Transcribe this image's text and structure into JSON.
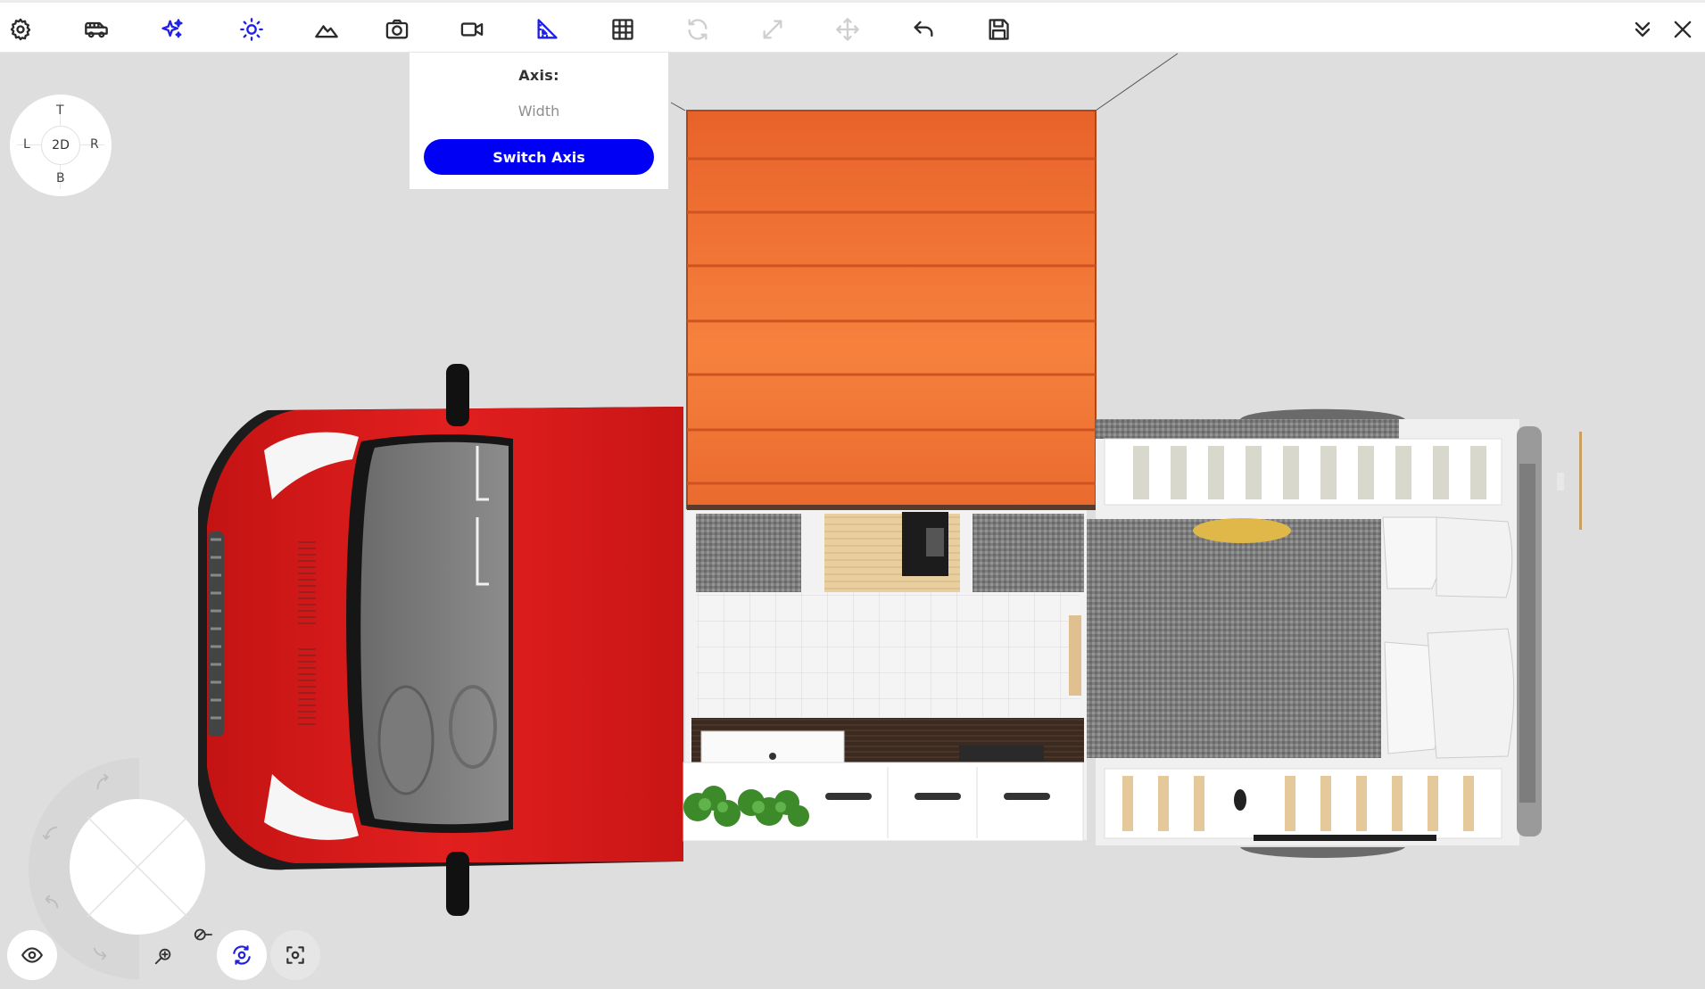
{
  "toolbar": {
    "left_icons": [
      {
        "name": "settings-gear-icon",
        "state": "normal"
      },
      {
        "name": "van-icon",
        "state": "normal"
      },
      {
        "name": "sparkle-icon",
        "state": "active"
      },
      {
        "name": "sun-lighting-icon",
        "state": "active"
      },
      {
        "name": "terrain-mountain-icon",
        "state": "normal"
      },
      {
        "name": "camera-icon",
        "state": "normal"
      },
      {
        "name": "video-camera-icon",
        "state": "normal"
      },
      {
        "name": "ruler-measure-icon",
        "state": "active"
      },
      {
        "name": "grid-icon",
        "state": "normal"
      },
      {
        "name": "rotate-icon",
        "state": "disabled"
      },
      {
        "name": "resize-icon",
        "state": "disabled"
      },
      {
        "name": "move-icon",
        "state": "disabled"
      },
      {
        "name": "undo-icon",
        "state": "normal"
      },
      {
        "name": "save-icon",
        "state": "normal"
      }
    ],
    "right_icons": [
      {
        "name": "collapse-chevrons-icon"
      },
      {
        "name": "close-icon"
      }
    ]
  },
  "axis_panel": {
    "title": "Axis:",
    "value": "Width",
    "button_label": "Switch Axis"
  },
  "viewcube": {
    "top": "T",
    "left": "L",
    "right": "R",
    "bottom": "B",
    "center": "2D"
  },
  "colors": {
    "accent_blue": "#0000f5",
    "toolbar_active": "#1f1fe6",
    "van_red": "#d81818",
    "awning_orange": "#f47a35",
    "background": "#dedede"
  }
}
